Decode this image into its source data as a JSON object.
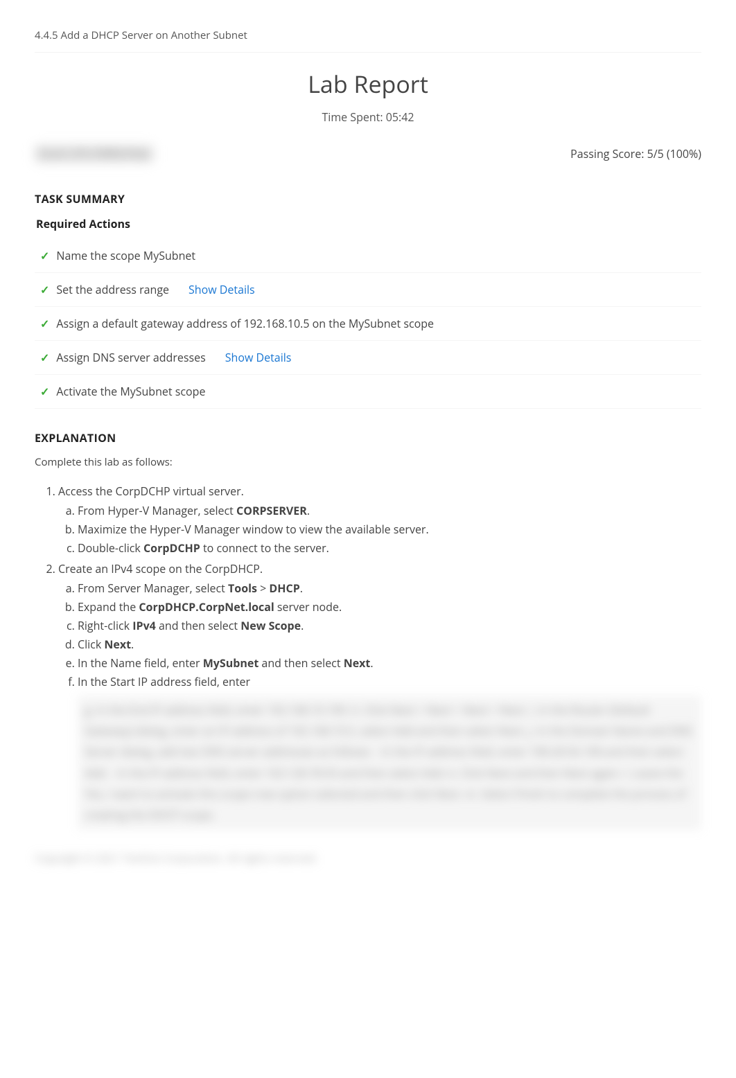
{
  "breadcrumb": "4.4.5 Add a DHCP Server on Another Subnet",
  "title": "Lab Report",
  "time_spent_label": "Time Spent: 05:42",
  "score_left_blurred": "Score: 5/5 (100%) Pass",
  "passing_score": "Passing Score: 5/5 (100%)",
  "task_summary_header": "TASK SUMMARY",
  "required_actions_header": "Required Actions",
  "tasks": [
    {
      "text": "Name the scope MySubnet",
      "details": false
    },
    {
      "text": "Set the address range",
      "details": true
    },
    {
      "text": "Assign a default gateway address of 192.168.10.5 on the MySubnet scope",
      "details": false
    },
    {
      "text": "Assign DNS server addresses",
      "details": true
    },
    {
      "text": "Activate the MySubnet scope",
      "details": false
    }
  ],
  "show_details_label": "Show Details",
  "explanation_header": "EXPLANATION",
  "explanation_intro": "Complete this lab as follows:",
  "steps": {
    "step1": {
      "title": "Access the CorpDCHP virtual server.",
      "a_pre": "From Hyper-V Manager, select ",
      "a_bold": "CORPSERVER",
      "a_post": ".",
      "b": "Maximize the Hyper-V Manager window to view the available server.",
      "c_pre": "Double-click ",
      "c_bold": "CorpDCHP",
      "c_post": " to connect to the server."
    },
    "step2": {
      "title": "Create an IPv4 scope on the CorpDHCP.",
      "a_pre": "From Server Manager, select ",
      "a_b1": "Tools",
      "a_mid": " > ",
      "a_b2": "DHCP",
      "a_post": ".",
      "b_pre": "Expand the ",
      "b_bold": "CorpDHCP.CorpNet.local",
      "b_post": " server node.",
      "c_pre": "Right-click ",
      "c_b1": "IPv4",
      "c_mid": " and then select ",
      "c_b2": "New Scope",
      "c_post": ".",
      "d_pre": "Click ",
      "d_bold": "Next",
      "d_post": ".",
      "e_pre": "In the Name field, enter ",
      "e_b1": "MySubnet",
      "e_mid": " and then select ",
      "e_b2": "Next",
      "e_post": ".",
      "f_pre": "In the Start IP address field, enter "
    }
  },
  "blurred_lines": "g. In the End IP address field, enter 192.168.10.199.\nh. Click Next > Next > Next > Next.\ni. In the Router (Default Gateway) dialog, enter an IP address of 192.168.10.5, select Add and then select Next.\nj. In the Domain Name and DNS Server dialog, add two DNS server addresses as follows:\n   - In the IP address field, enter 198.28.56.108 and then select Add.\n   - In the IP address field, enter 163.128.78.93 and then select Add.\nk. Click Next and then Next again.\nl. Leave the Yes, I want to activate this scope now option selected and then click Next.\nm. Select Finish to complete the process of creating the DHCP scope.",
  "footer_blurred": "Copyright © 2021 TestOut Corporation. All rights reserved."
}
